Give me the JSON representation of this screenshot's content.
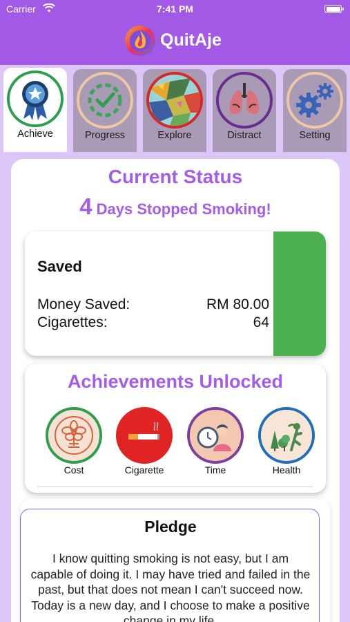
{
  "status_bar": {
    "carrier": "Carrier",
    "time": "7:41 PM"
  },
  "header": {
    "title": "QuitAje"
  },
  "tabs": [
    {
      "label": "Achieve",
      "ring_color": "#2e9e4e",
      "active": true
    },
    {
      "label": "Progress",
      "ring_color": "#f0c6a2",
      "active": false
    },
    {
      "label": "Explore",
      "ring_color": "#d62828",
      "active": false
    },
    {
      "label": "Distract",
      "ring_color": "#6a2c91",
      "active": false
    },
    {
      "label": "Setting",
      "ring_color": "#f0c6a2",
      "active": false
    }
  ],
  "status": {
    "title": "Current Status",
    "days": "4",
    "days_text": "Days Stopped Smoking!"
  },
  "saved": {
    "title": "Saved",
    "money_label": "Money Saved:",
    "money_value": "RM 80.00",
    "cigarettes_label": "Cigarettes:",
    "cigarettes_value": "64",
    "bar_color": "#4caf50"
  },
  "achievements": {
    "title": "Achievements Unlocked",
    "items": [
      {
        "label": "Cost",
        "ring_color": "#2e9e4e"
      },
      {
        "label": "Cigarette",
        "ring_color": "#e02424"
      },
      {
        "label": "Time",
        "ring_color": "#7b3fa0"
      },
      {
        "label": "Health",
        "ring_color": "#1f6fb8"
      }
    ]
  },
  "pledge": {
    "title": "Pledge",
    "text": "I know quitting smoking is not easy, but I am capable of doing it. I may have tried and failed in the past, but that does not mean I can't succeed now. Today is a new day, and I choose to make a positive change in my life."
  },
  "colors": {
    "accent": "#a35de6",
    "header": "#a25ae6",
    "background": "#dcc6f7"
  }
}
